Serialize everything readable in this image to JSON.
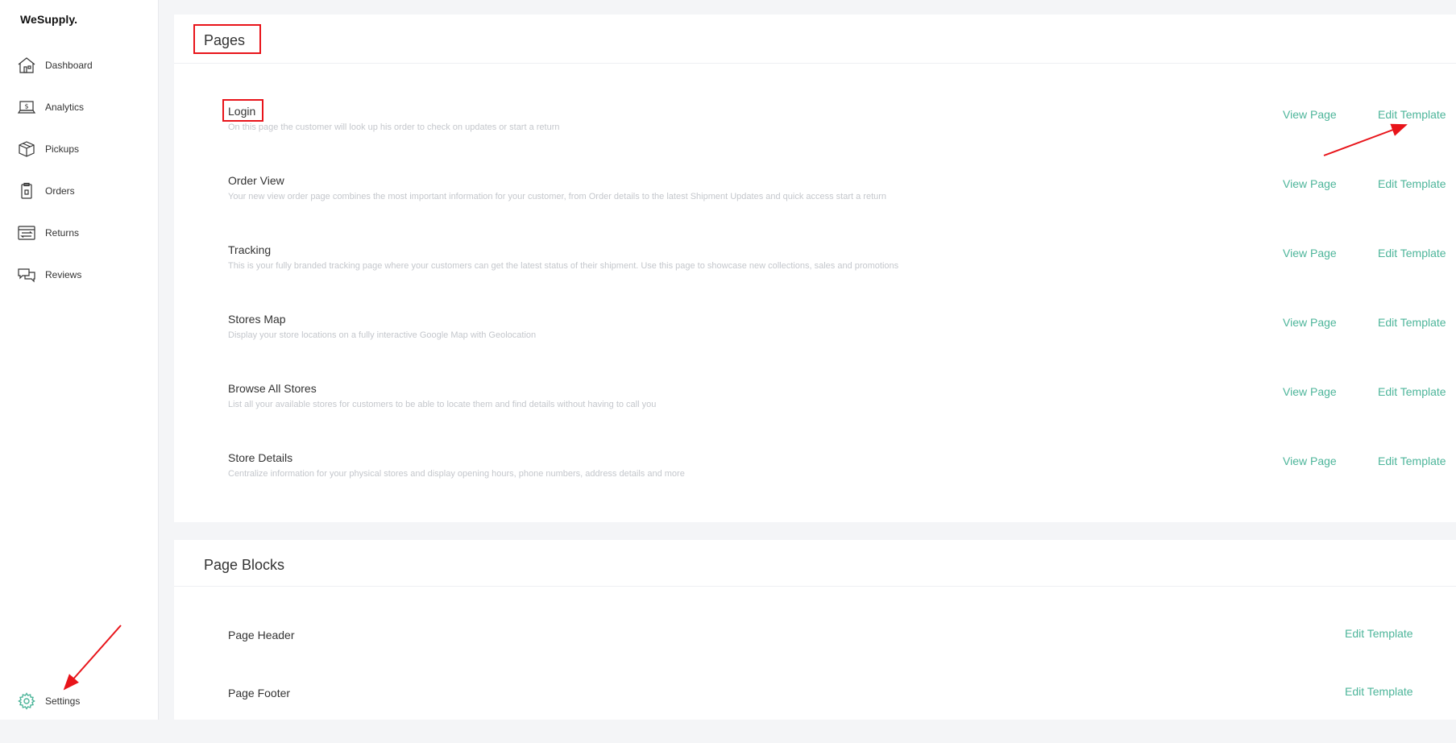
{
  "app": {
    "logo": "WeSupply."
  },
  "sidebar": {
    "items": [
      {
        "label": "Dashboard",
        "icon": "house-icon"
      },
      {
        "label": "Analytics",
        "icon": "laptop-dollar-icon"
      },
      {
        "label": "Pickups",
        "icon": "box-icon"
      },
      {
        "label": "Orders",
        "icon": "clipboard-icon"
      },
      {
        "label": "Returns",
        "icon": "returns-icon"
      },
      {
        "label": "Reviews",
        "icon": "chat-icon"
      }
    ],
    "settings": {
      "label": "Settings",
      "icon": "gear-icon"
    }
  },
  "pages": {
    "title": "Pages",
    "view_label": "View Page",
    "edit_label": "Edit Template",
    "rows": [
      {
        "title": "Login",
        "desc": "On this page the customer will look up his order to check on updates or start a return"
      },
      {
        "title": "Order View",
        "desc": "Your new view order page combines the most important information for your customer, from Order details to the latest Shipment Updates and quick access start a return"
      },
      {
        "title": "Tracking",
        "desc": "This is your fully branded tracking page where your customers can get the latest status of their shipment. Use this page to showcase new collections, sales and promotions"
      },
      {
        "title": "Stores Map",
        "desc": "Display your store locations on a fully interactive Google Map with Geolocation"
      },
      {
        "title": "Browse All Stores",
        "desc": "List all your available stores for customers to be able to locate them and find details without having to call you"
      },
      {
        "title": "Store Details",
        "desc": "Centralize information for your physical stores and display opening hours, phone numbers, address details and more"
      }
    ]
  },
  "page_blocks": {
    "title": "Page Blocks",
    "edit_label": "Edit Template",
    "rows": [
      {
        "title": "Page Header"
      },
      {
        "title": "Page Footer"
      }
    ]
  },
  "colors": {
    "accent": "#4db59a",
    "annotation": "#e8141a",
    "background": "#f4f5f7"
  }
}
